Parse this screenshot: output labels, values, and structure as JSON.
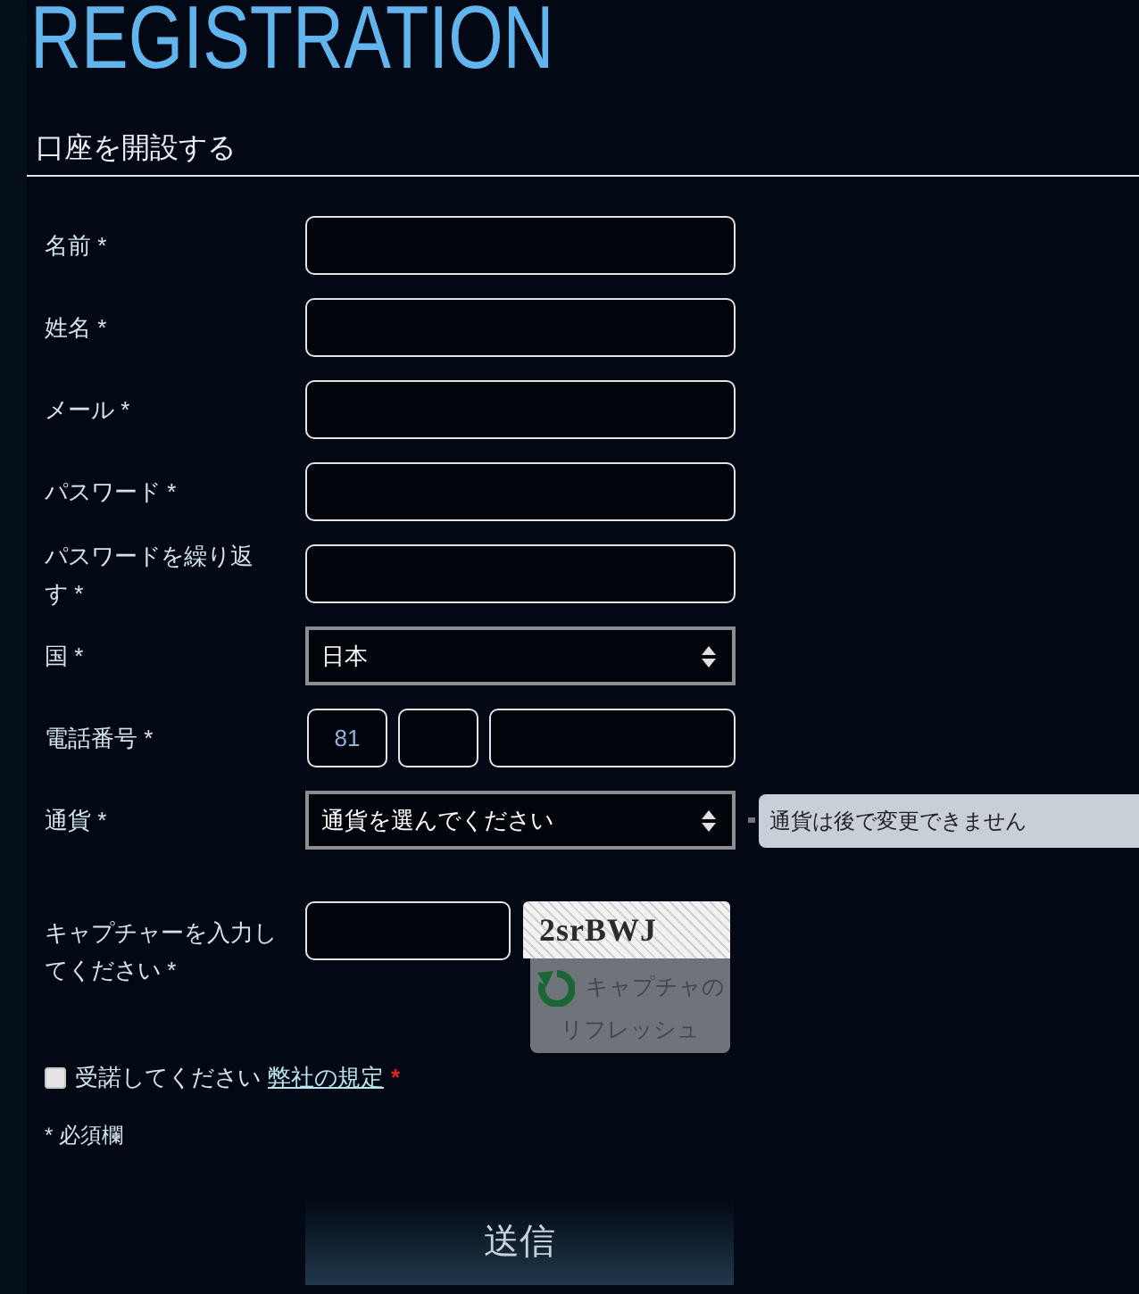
{
  "title": "REGISTRATION",
  "section": {
    "title": "口座を開設する"
  },
  "fields": [
    {
      "kind": "text",
      "label": "名前 *"
    },
    {
      "kind": "text",
      "label": "姓名 *"
    },
    {
      "kind": "text",
      "label": "メール *"
    },
    {
      "kind": "password",
      "label": "パスワード *"
    },
    {
      "kind": "password",
      "label": "パスワードを繰り返す *"
    },
    {
      "kind": "select",
      "label": "国 *",
      "value": "日本"
    },
    {
      "kind": "phone",
      "label": "電話番号 *",
      "country_code": "81"
    },
    {
      "kind": "select",
      "label": "通貨 *",
      "value": "通貨を選んでください",
      "tooltip": "通貨は後で変更できません"
    }
  ],
  "captcha": {
    "label": "キャプチャーを入力してください *",
    "code": "2srBWJ",
    "refresh_button": "キャプチャのリフレッシュ"
  },
  "terms": {
    "checked": false,
    "text": "受諾してください",
    "link": "弊社の規定",
    "required_mark": "*"
  },
  "required_note": "* 必須欄",
  "submit_button": "送信"
}
